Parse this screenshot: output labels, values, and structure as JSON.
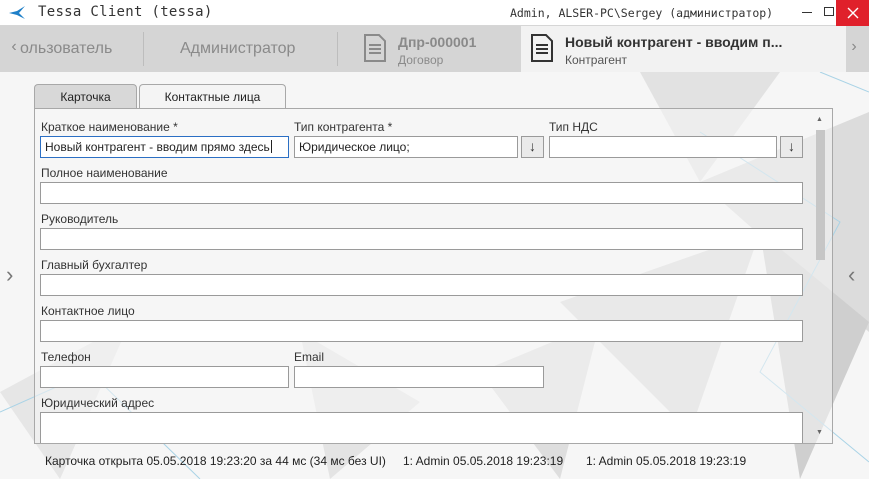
{
  "window": {
    "title": "Tessa Client (tessa)",
    "user_info": "Admin, ALSER-PC\\Sergey (администратор)",
    "close_color": "#e0202b"
  },
  "tabs": {
    "scroll_left": "‹",
    "scroll_right": "›",
    "user_tab": "ользователь",
    "admin_tab": "Администратор",
    "doc_tabs": [
      {
        "title": "Дпр-000001",
        "subtitle": "Договор",
        "icon": "document-icon"
      },
      {
        "title": "Новый контрагент - вводим п...",
        "subtitle": "Контрагент",
        "icon": "document-icon"
      }
    ]
  },
  "card": {
    "inner_tabs": [
      "Карточка",
      "Контактные лица"
    ],
    "side_left": "‹",
    "side_right": "‹",
    "fields": {
      "short_name": {
        "label": "Краткое наименование  *",
        "value": "Новый контрагент - вводим прямо здесь"
      },
      "contractor_type": {
        "label": "Тип контрагента  *",
        "value": "Юридическое лицо;"
      },
      "vat_type": {
        "label": "Тип НДС",
        "value": ""
      },
      "full_name": {
        "label": "Полное наименование",
        "value": ""
      },
      "director": {
        "label": "Руководитель",
        "value": ""
      },
      "chief_accountant": {
        "label": "Главный бухгалтер",
        "value": ""
      },
      "contact_person": {
        "label": "Контактное лицо",
        "value": ""
      },
      "phone": {
        "label": "Телефон",
        "value": ""
      },
      "email": {
        "label": "Email",
        "value": ""
      },
      "legal_address": {
        "label": "Юридический адрес",
        "value": ""
      }
    },
    "dropdown_glyph": "↓"
  },
  "status": {
    "opened": "Карточка открыта 05.05.2018 19:23:20 за 44 мс (34 мс без UI)",
    "entry1": "1:  Admin  05.05.2018 19:23:19",
    "entry2": "1:  Admin  05.05.2018 19:23:19"
  }
}
